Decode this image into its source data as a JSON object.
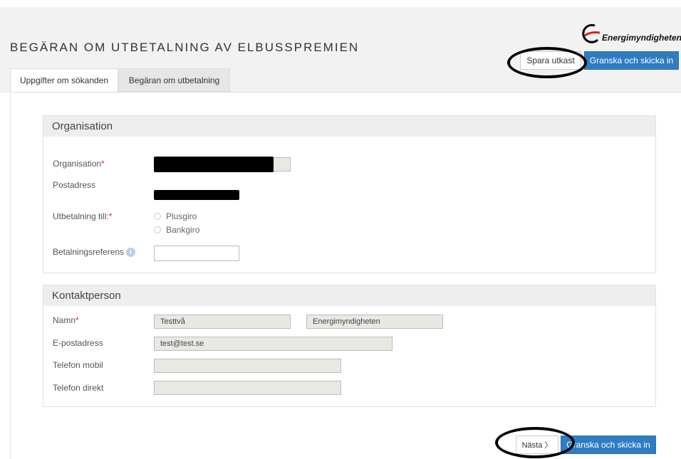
{
  "header": {
    "title": "BEGÄRAN OM UTBETALNING AV ELBUSSPREMIEN",
    "logo_text": "Energimyndigheten",
    "save_draft_label": "Spara utkast",
    "review_submit_label": "Granska och skicka in"
  },
  "tabs": [
    {
      "label": "Uppgifter om sökanden",
      "active": true
    },
    {
      "label": "Begäran om utbetalning",
      "active": false
    }
  ],
  "organisation": {
    "heading": "Organisation",
    "org_label": "Organisation",
    "postal_label": "Postadress",
    "payment_label": "Utbetalning till:",
    "payment_options": [
      "Plusgiro",
      "Bankgiro"
    ],
    "reference_label": "Betalningsreferens",
    "reference_value": ""
  },
  "contact": {
    "heading": "Kontaktperson",
    "name_label": "Namn",
    "first_name": "Testtvå",
    "last_name": "Energimyndigheten",
    "email_label": "E-postadress",
    "email": "test@test.se",
    "mobile_label": "Telefon mobil",
    "mobile": "",
    "direct_label": "Telefon direkt",
    "direct": ""
  },
  "footer": {
    "next_label": "Nästa 〉",
    "review_submit_label": "Granska och skicka in"
  },
  "required_mark": "*",
  "colors": {
    "primary": "#2e7dc2",
    "required": "#c0392b",
    "logo_red": "#d2232a"
  }
}
